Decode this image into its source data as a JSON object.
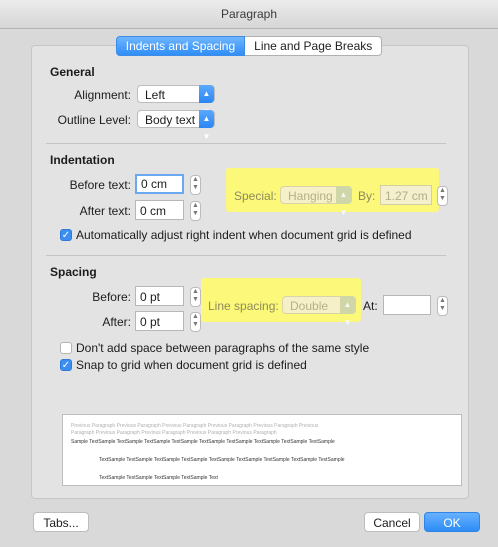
{
  "window": {
    "title": "Paragraph"
  },
  "tabs": [
    {
      "label": "Indents and Spacing",
      "active": true
    },
    {
      "label": "Line and Page Breaks",
      "active": false
    }
  ],
  "general": {
    "title": "General",
    "alignment_label": "Alignment:",
    "alignment_value": "Left",
    "outline_label": "Outline Level:",
    "outline_value": "Body text"
  },
  "indentation": {
    "title": "Indentation",
    "before_label": "Before text:",
    "before_value": "0 cm",
    "after_label": "After text:",
    "after_value": "0 cm",
    "special_label": "Special:",
    "special_value": "Hanging",
    "by_label": "By:",
    "by_value": "1.27 cm",
    "auto_adjust_label": "Automatically adjust right indent when document grid is defined",
    "auto_adjust_checked": true
  },
  "spacing": {
    "title": "Spacing",
    "before_label": "Before:",
    "before_value": "0 pt",
    "after_label": "After:",
    "after_value": "0 pt",
    "line_spacing_label": "Line spacing:",
    "line_spacing_value": "Double",
    "at_label": "At:",
    "at_value": "",
    "dont_add_label": "Don't add space between paragraphs of the same style",
    "dont_add_checked": false,
    "snap_label": "Snap to grid when document grid is defined",
    "snap_checked": true
  },
  "preview": {
    "prev_line_1": "Previous Paragraph Previous Paragraph Previous Paragraph Previous Paragraph Previous Paragraph Previous",
    "prev_line_2": "Paragraph Previous Paragraph Previous Paragraph Previous Paragraph Previous Paragraph",
    "sample_line_1": "Sample TextSample TextSample TextSample TextSample TextSample TextSample TextSample TextSample TextSample",
    "sample_line_2": "TextSample TextSample TextSample TextSample TextSample TextSample TextSample TextSample TextSample",
    "sample_line_3": "TextSample TextSample TextSample TextSample Text"
  },
  "buttons": {
    "tabs": "Tabs...",
    "cancel": "Cancel",
    "ok": "OK"
  },
  "colors": {
    "accent": "#2f8ef7",
    "highlight": "#fbf87a"
  },
  "icons": {
    "popup_arrow": "updown-chevron-icon",
    "stepper": "stepper-arrows-icon",
    "check": "checkmark-icon"
  }
}
